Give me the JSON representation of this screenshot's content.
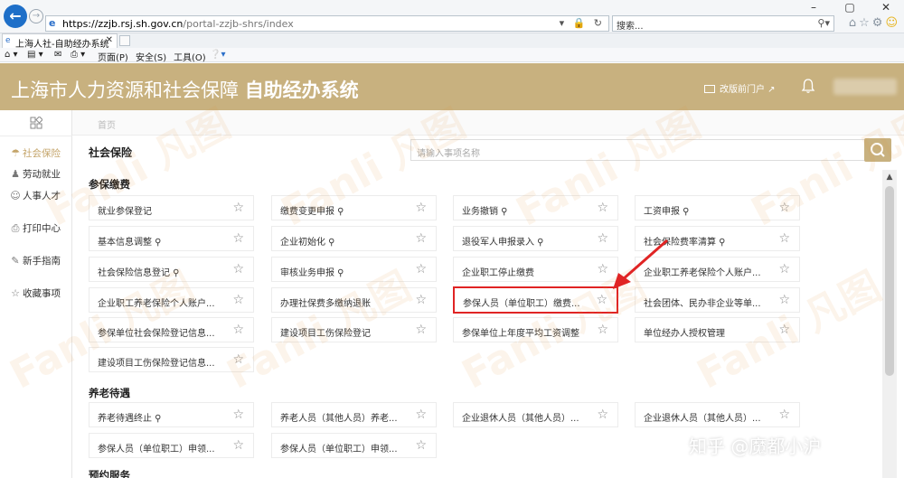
{
  "browser": {
    "url_host": "https://zzjb.rsj.sh.gov.cn",
    "url_path": "/portal-zzjb-shrs/index",
    "search_placeholder": "搜索...",
    "tab_title": "上海人社-自助经办系统",
    "commands": {
      "page": "页面(P)",
      "safety": "安全(S)",
      "tools": "工具(O)"
    }
  },
  "header": {
    "title_prefix": "上海市人力资源和社会保障 ",
    "title_bold": "自助经办系统",
    "old_portal": "改版前门户"
  },
  "sidebar": {
    "items": [
      {
        "label": "社会保险",
        "icon": "umbrella-icon"
      },
      {
        "label": "劳动就业",
        "icon": "person-icon"
      },
      {
        "label": "人事人才",
        "icon": "user-icon"
      },
      {
        "label": "打印中心",
        "icon": "printer-icon"
      },
      {
        "label": "新手指南",
        "icon": "guide-icon"
      },
      {
        "label": "收藏事项",
        "icon": "star-icon"
      }
    ]
  },
  "breadcrumb": "首页",
  "section": {
    "title": "社会保险",
    "search_placeholder": "请输入事项名称"
  },
  "categories": [
    {
      "title": "参保缴费",
      "items": [
        [
          "就业参保登记",
          "缴费变更申报 ⚲",
          "业务撤销 ⚲",
          "工资申报 ⚲"
        ],
        [
          "基本信息调整 ⚲",
          "企业初始化 ⚲",
          "退役军人申报录入 ⚲",
          "社会保险费率清算 ⚲"
        ],
        [
          "社会保险信息登记 ⚲",
          "审核业务申报 ⚲",
          "企业职工停止缴费",
          "企业职工养老保险个人账户..."
        ],
        [
          "企业职工养老保险个人账户...",
          "办理社保费多缴纳退账",
          "参保人员（单位职工）缴费...",
          "社会团体、民办非企业等单..."
        ],
        [
          "参保单位社会保险登记信息...",
          "建设项目工伤保险登记",
          "参保单位上年度平均工资调整",
          "单位经办人授权管理"
        ],
        [
          "建设项目工伤保险登记信息..."
        ]
      ]
    },
    {
      "title": "养老待遇",
      "items": [
        [
          "养老待遇终止 ⚲",
          "养老人员（其他人员）养老...",
          "企业退休人员（其他人员）...",
          "企业退休人员（其他人员）..."
        ],
        [
          "参保人员（单位职工）申领...",
          "参保人员（单位职工）申领..."
        ]
      ]
    },
    {
      "title": "预约服务"
    }
  ],
  "watermark": "Fanli 凡图",
  "zhihu": "知乎 @魔都小沪"
}
